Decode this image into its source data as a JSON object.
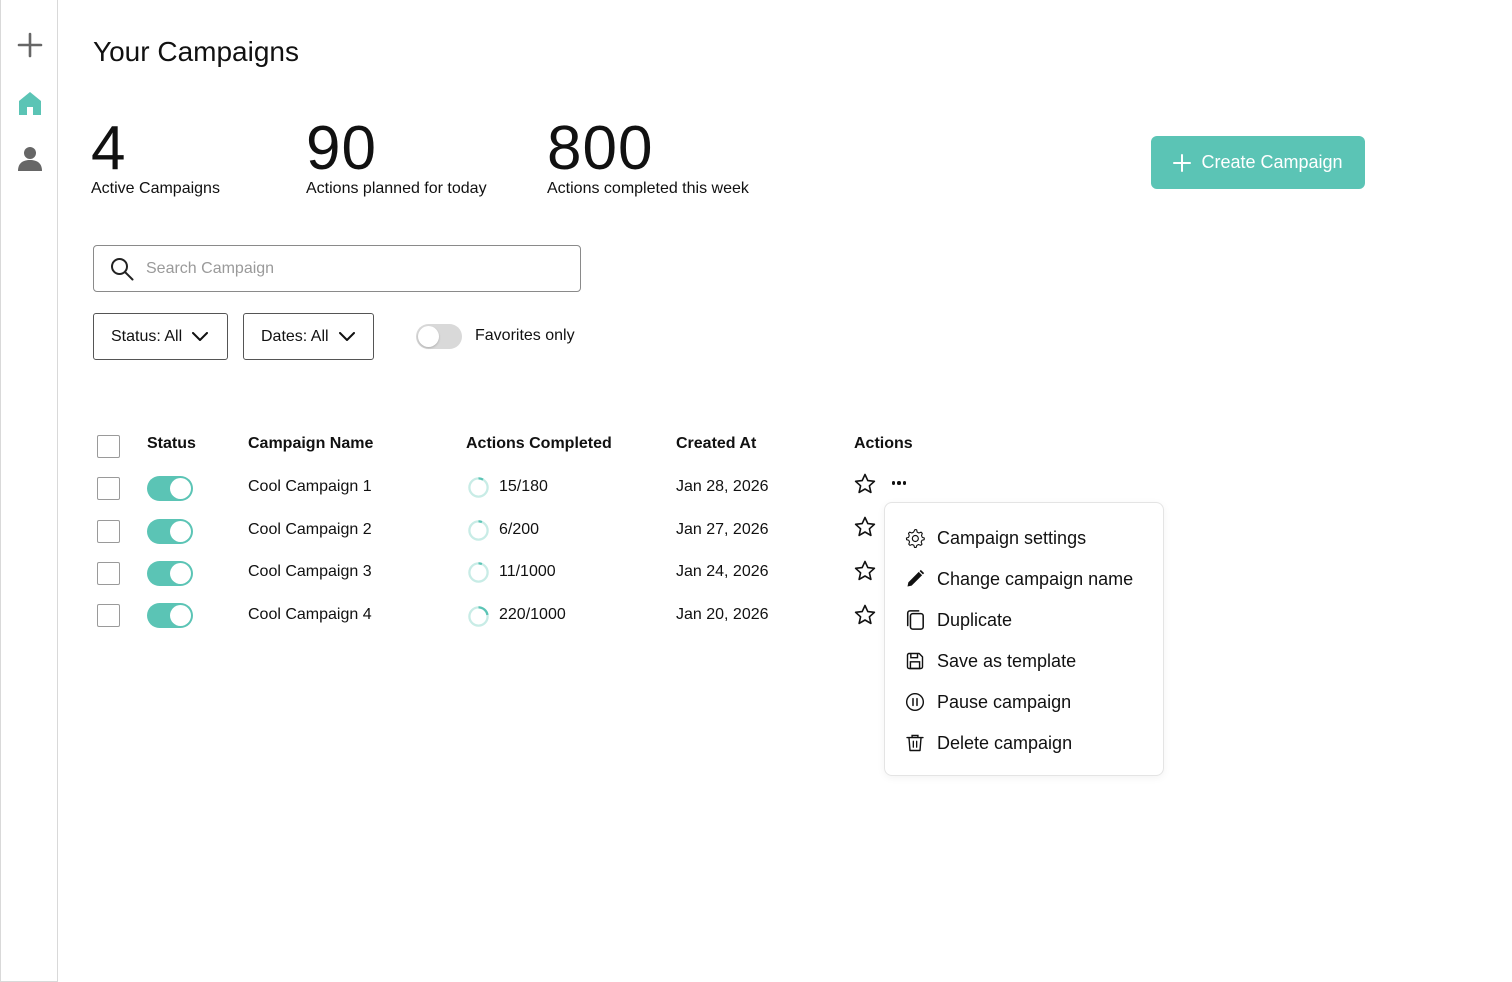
{
  "sidebar": {
    "items": [
      {
        "name": "add",
        "icon": "plus-icon"
      },
      {
        "name": "home",
        "icon": "home-icon",
        "active": true
      },
      {
        "name": "profile",
        "icon": "user-icon"
      }
    ],
    "accent": "#5bc4b5"
  },
  "page": {
    "title": "Your Campaigns"
  },
  "stats": [
    {
      "value": "4",
      "label": "Active Campaigns"
    },
    {
      "value": "90",
      "label": "Actions planned for today"
    },
    {
      "value": "800",
      "label": "Actions completed this week"
    }
  ],
  "create_button": {
    "label": "Create Campaign",
    "icon": "plus-icon",
    "color": "#5bc4b5"
  },
  "search": {
    "placeholder": "Search Campaign",
    "value": ""
  },
  "filters": {
    "status_label": "Status: All",
    "dates_label": "Dates: All",
    "favorites_label": "Favorites only",
    "favorites_on": false
  },
  "table": {
    "headers": {
      "status": "Status",
      "name": "Campaign Name",
      "actions_completed": "Actions Completed",
      "created_at": "Created At",
      "actions": "Actions"
    },
    "rows": [
      {
        "active": true,
        "name": "Cool Campaign 1",
        "progress": "15/180",
        "progress_fraction": 0.083,
        "created": "Jan 28, 2026",
        "favorite": false
      },
      {
        "active": true,
        "name": "Cool Campaign 2",
        "progress": "6/200",
        "progress_fraction": 0.03,
        "created": "Jan 27, 2026",
        "favorite": false
      },
      {
        "active": true,
        "name": "Cool Campaign 3",
        "progress": "11/1000",
        "progress_fraction": 0.011,
        "created": "Jan 24, 2026",
        "favorite": false
      },
      {
        "active": true,
        "name": "Cool Campaign 4",
        "progress": "220/1000",
        "progress_fraction": 0.22,
        "created": "Jan 20, 2026",
        "favorite": false
      }
    ]
  },
  "context_menu": {
    "items": [
      {
        "label": "Campaign settings",
        "icon": "gear-icon"
      },
      {
        "label": "Change campaign name",
        "icon": "pencil-icon"
      },
      {
        "label": "Duplicate",
        "icon": "duplicate-icon"
      },
      {
        "label": "Save as template",
        "icon": "save-icon"
      },
      {
        "label": "Pause campaign",
        "icon": "pause-icon"
      },
      {
        "label": "Delete campaign",
        "icon": "trash-icon"
      }
    ]
  }
}
